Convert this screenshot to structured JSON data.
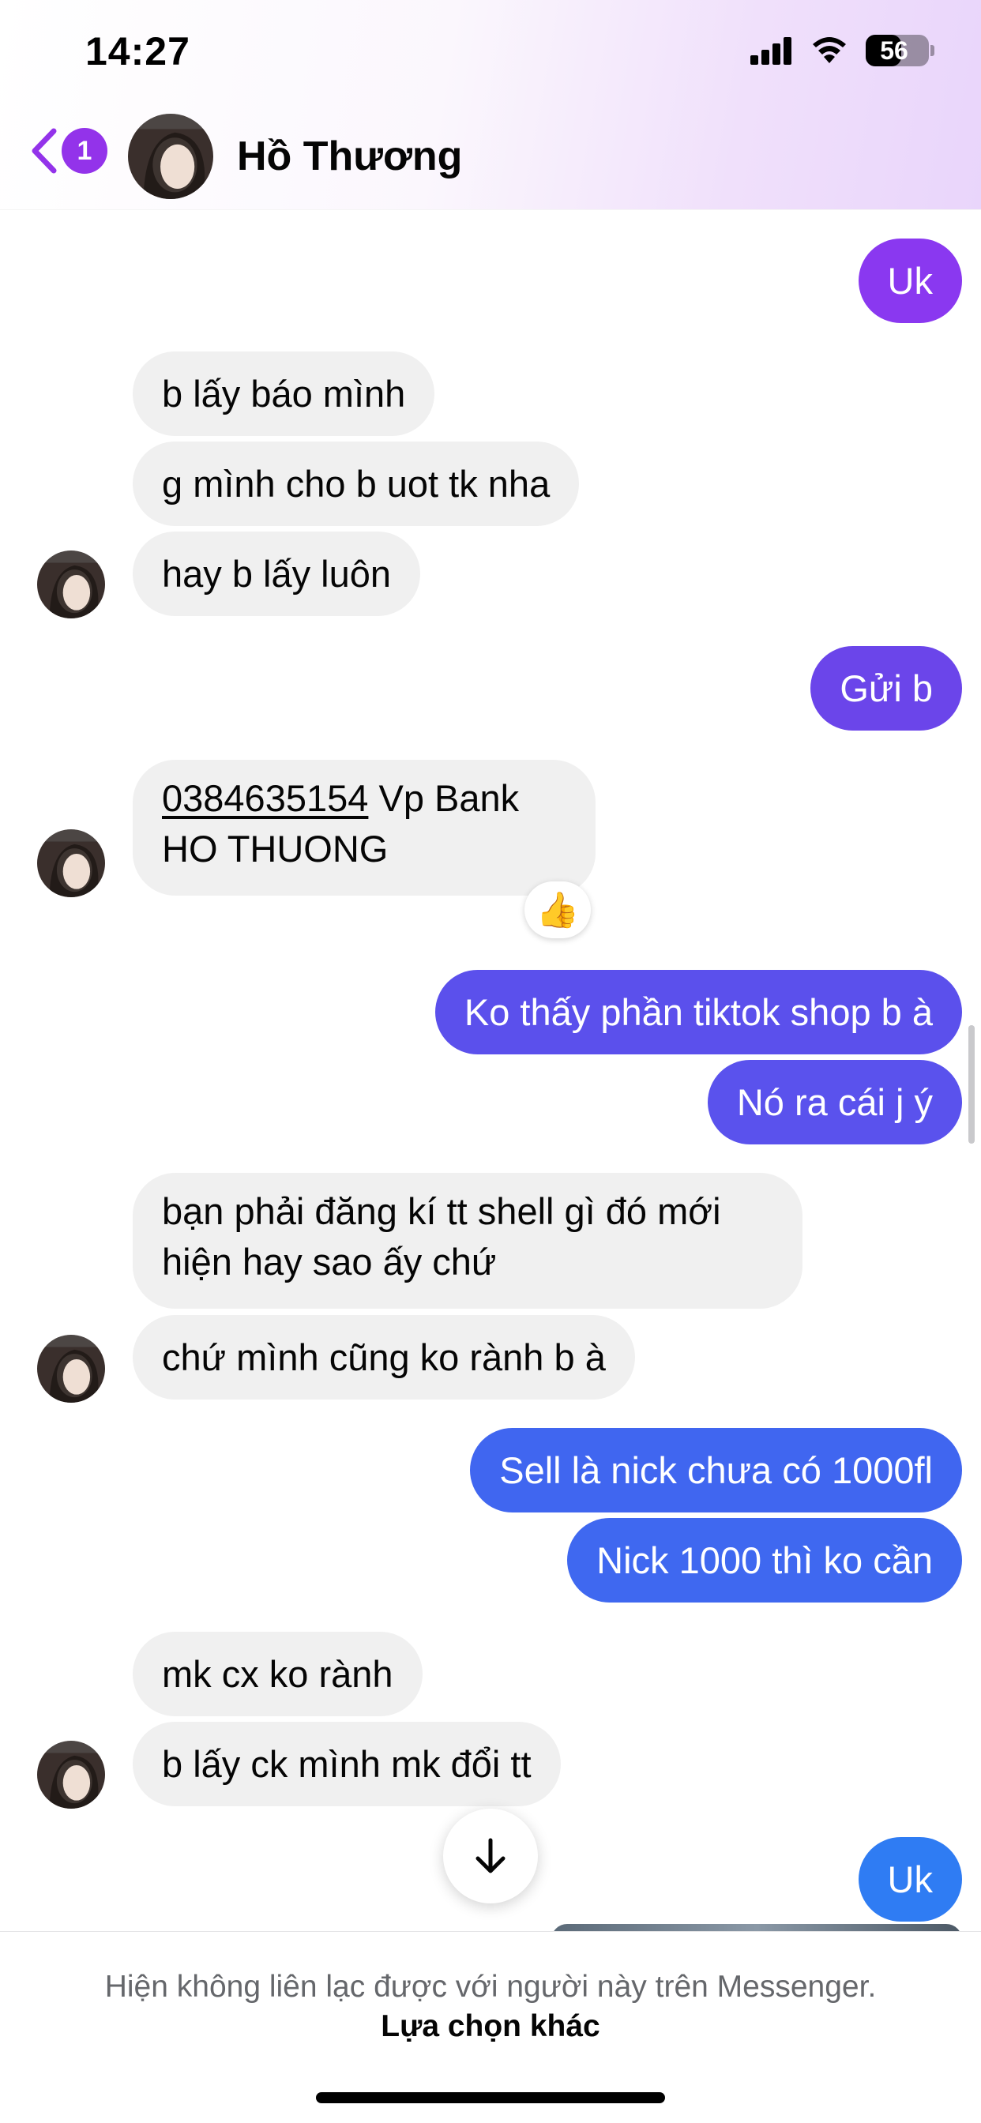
{
  "status_bar": {
    "time": "14:27",
    "battery": "56",
    "battery_level": 0.56
  },
  "header": {
    "unread_count": "1",
    "contact_name": "Hồ Thương"
  },
  "colors": {
    "accent": "#9333ea",
    "incoming_bubble": "#f0f0f0"
  },
  "messages": [
    {
      "from": "me",
      "text": "Uk",
      "color": "#8a38f0"
    },
    {
      "from": "contact",
      "text": "b lấy báo mình"
    },
    {
      "from": "contact",
      "text": "g mình cho b uot tk nha"
    },
    {
      "from": "contact",
      "text": "hay b lấy luôn"
    },
    {
      "from": "me",
      "text": "Gửi b",
      "color": "#6b45ea"
    },
    {
      "from": "contact",
      "phone": "0384635154",
      "text_after": " Vp Bank",
      "line2": "HO THUONG",
      "reaction": "👍"
    },
    {
      "from": "me",
      "text": "Ko thấy phần tiktok shop b à",
      "color": "#5b50ec"
    },
    {
      "from": "me",
      "text": "Nó ra cái j ý",
      "color": "#5a52ed"
    },
    {
      "from": "contact",
      "text": "bạn phải đăng kí tt shell gì đó mới hiện hay sao ấy chứ"
    },
    {
      "from": "contact",
      "text": "chứ mình cũng ko rành b à"
    },
    {
      "from": "me",
      "text": "Sell là nick chưa có 1000fl",
      "color": "#4066f0"
    },
    {
      "from": "me",
      "text": "Nick 1000 thì ko cần",
      "color": "#3f68f0"
    },
    {
      "from": "contact",
      "text": "mk cx ko rành"
    },
    {
      "from": "contact",
      "text": "b lấy ck mình mk đổi tt"
    },
    {
      "from": "me",
      "text": "Uk",
      "color": "#2f7cf3"
    }
  ],
  "footer": {
    "notice": "Hiện không liên lạc được với người này trên Messenger.",
    "other_options": "Lựa chọn khác"
  },
  "icons": [
    "back-chevron-icon",
    "signal-icon",
    "wifi-icon",
    "battery-icon",
    "arrow-down-icon",
    "thumbs-up-icon"
  ]
}
